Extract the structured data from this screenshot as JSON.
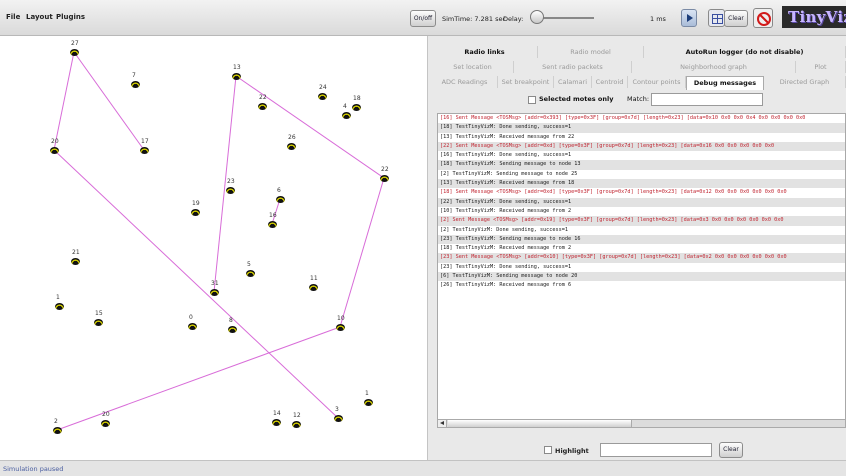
{
  "menu": {
    "file": "File",
    "layout": "Layout",
    "plugins": "Plugins"
  },
  "toolbar": {
    "onoff_label": "On/off",
    "sim_time": "SimTime: 7.281 sec",
    "delay_label": "Delay:",
    "delay_value": "1 ms",
    "clear_label": "Clear",
    "logo": "TinyViz"
  },
  "tabs": {
    "row1": [
      "Radio links",
      "Radio model",
      "AutoRun logger (do not disable)"
    ],
    "row2": [
      "Set location",
      "Sent radio packets",
      "Neighborhood graph",
      "Plot"
    ],
    "row3": [
      "ADC Readings",
      "Set breakpoint",
      "Calamari",
      "Centroid",
      "Contour points",
      "Debug messages",
      "Directed Graph"
    ]
  },
  "filter": {
    "selected_label": "Selected motes only",
    "match_label": "Match:",
    "match_value": ""
  },
  "log": [
    {
      "text": "[16] Sent Message <TOSMsg>  [addr=0x393]  [type=0x3F]  [group=0x7d]  [length=0x23]  [data=0x10 0x0 0x0 0x4 0x0 0x0 0x0 0x0",
      "sent": true
    },
    {
      "text": "[18] TestTinyVizM: Done sending, success=1",
      "sent": false
    },
    {
      "text": "[13] TestTinyVizM: Received message from 22",
      "sent": false
    },
    {
      "text": "[22] Sent Message <TOSMsg>  [addr=0xd]  [type=0x3F]  [group=0x7d]  [length=0x23]  [data=0x16 0x0 0x0 0x0 0x0 0x0",
      "sent": true
    },
    {
      "text": "[16] TestTinyVizM: Done sending, success=1",
      "sent": false
    },
    {
      "text": "[18] TestTinyVizM: Sending message to node 13",
      "sent": false
    },
    {
      "text": "[2] TestTinyVizM: Sending message to node 25",
      "sent": false
    },
    {
      "text": "[13] TestTinyVizM: Received message from 18",
      "sent": false
    },
    {
      "text": "[18] Sent Message <TOSMsg>  [addr=0xd]  [type=0x3F]  [group=0x7d]  [length=0x23]  [data=0x12 0x0 0x0 0x0 0x0 0x0 0x0",
      "sent": true
    },
    {
      "text": "[22] TestTinyVizM: Done sending, success=1",
      "sent": false
    },
    {
      "text": "[10] TestTinyVizM: Received message from 2",
      "sent": false
    },
    {
      "text": "[2] Sent Message <TOSMsg>  [addr=0x19]  [type=0x3F]  [group=0x7d]  [length=0x23]  [data=0x3 0x0 0x0 0x0 0x0 0x0 0x0",
      "sent": true
    },
    {
      "text": "[2] TestTinyVizM: Done sending, success=1",
      "sent": false
    },
    {
      "text": "[23] TestTinyVizM: Sending message to node 16",
      "sent": false
    },
    {
      "text": "[18] TestTinyVizM: Received message from 2",
      "sent": false
    },
    {
      "text": "[23] Sent Message <TOSMsg>  [addr=0x10]  [type=0x3F]  [group=0x7d]  [length=0x23]  [data=0x2 0x0 0x0 0x0 0x0 0x0 0x0",
      "sent": true
    },
    {
      "text": "[23] TestTinyVizM: Done sending, success=1",
      "sent": false
    },
    {
      "text": "[6] TestTinyVizM: Sending message to node 20",
      "sent": false
    },
    {
      "text": "[26] TestTinyVizM: Received message from 6",
      "sent": false
    }
  ],
  "bottom": {
    "highlight_label": "Highlight",
    "highlight_value": "",
    "clear_label": "Clear"
  },
  "status": "Simulation paused",
  "motes": [
    {
      "id": "27"
    },
    {
      "id": "7"
    },
    {
      "id": "13"
    },
    {
      "id": "24"
    },
    {
      "id": "20"
    },
    {
      "id": "22"
    },
    {
      "id": "4"
    },
    {
      "id": "18"
    },
    {
      "id": "26"
    },
    {
      "id": "17"
    },
    {
      "id": "22"
    },
    {
      "id": "23"
    },
    {
      "id": "6"
    },
    {
      "id": "19"
    },
    {
      "id": "16"
    },
    {
      "id": "21"
    },
    {
      "id": "11"
    },
    {
      "id": "5"
    },
    {
      "id": "31"
    },
    {
      "id": "1"
    },
    {
      "id": "15"
    },
    {
      "id": "0"
    },
    {
      "id": "8"
    },
    {
      "id": "10"
    },
    {
      "id": "1"
    },
    {
      "id": "2"
    },
    {
      "id": "20"
    },
    {
      "id": "14"
    },
    {
      "id": "12"
    },
    {
      "id": "3"
    }
  ],
  "colors": {
    "link": "#d86cd8",
    "log_sent": "#c0232f",
    "status": "#4a5ea0",
    "logo_bg": "#2a2a2a",
    "logo_text": "#c8b6ff"
  }
}
